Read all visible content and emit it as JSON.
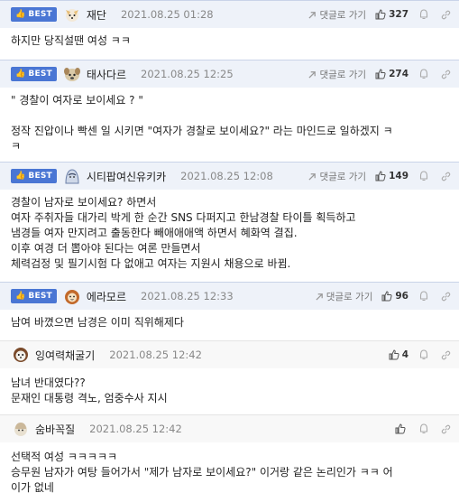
{
  "ui": {
    "best_label": "BEST",
    "reply_label": "댓글로 가기"
  },
  "comments": [
    {
      "nick": "재단",
      "date": "2021.08.25 01:28",
      "up": "327",
      "lines": [
        "하지만 당직설땐 여성 ㅋㅋ"
      ]
    },
    {
      "nick": "태사다르",
      "date": "2021.08.25 12:25",
      "up": "274",
      "lines": [
        "\" 경찰이 여자로 보이세요 ? \"",
        "",
        "정작 진압이나 빡센 일 시키면 \"여자가 경찰로 보이세요?\" 라는 마인드로 일하겠지 ㅋ",
        "ㅋ"
      ]
    },
    {
      "nick": "시티팝여신유키카",
      "date": "2021.08.25 12:08",
      "up": "149",
      "lines": [
        "경찰이 남자로 보이세요? 하면서",
        "여자 주취자들 대가리 박게 한 순간 SNS 다퍼지고 한남경찰 타이틀 획득하고",
        "냄경들 여자 만지려고 출동한다 빼애애애액 하면서 혜화역 결집.",
        "이후 여경 더 뽑아야 된다는 여론 만들면서",
        "체력검정 및 필기시험 다 없애고 여자는 지원시 채용으로 바뀜."
      ]
    },
    {
      "nick": "에라모르",
      "date": "2021.08.25 12:33",
      "up": "96",
      "lines": [
        "남여 바꼈으면 남경은 이미 직위해제다"
      ]
    },
    {
      "nick": "잉여력채굴기",
      "date": "2021.08.25 12:42",
      "up": "4",
      "lines": [
        "남녀 반대였다??",
        "문재인 대통령 격노, 엄중수사 지시"
      ]
    },
    {
      "nick": "숨바꼭질",
      "date": "2021.08.25 12:42",
      "up": "",
      "lines": [
        "선택적 여성 ㅋㅋㅋㅋㅋ",
        "승무원 남자가 여탕 들어가서 \"제가 남자로 보이세요?\" 이거랑 같은 논리인가 ㅋㅋ 어",
        "이가 없네"
      ]
    }
  ],
  "colors": {
    "best_badge": "#4a76d4",
    "best_header_bg": "#eef2f9",
    "normal_header_bg": "#f8f8f8"
  },
  "icons": [
    "thumbs-up-icon",
    "reply-arrow-icon",
    "report-icon",
    "link-icon"
  ]
}
